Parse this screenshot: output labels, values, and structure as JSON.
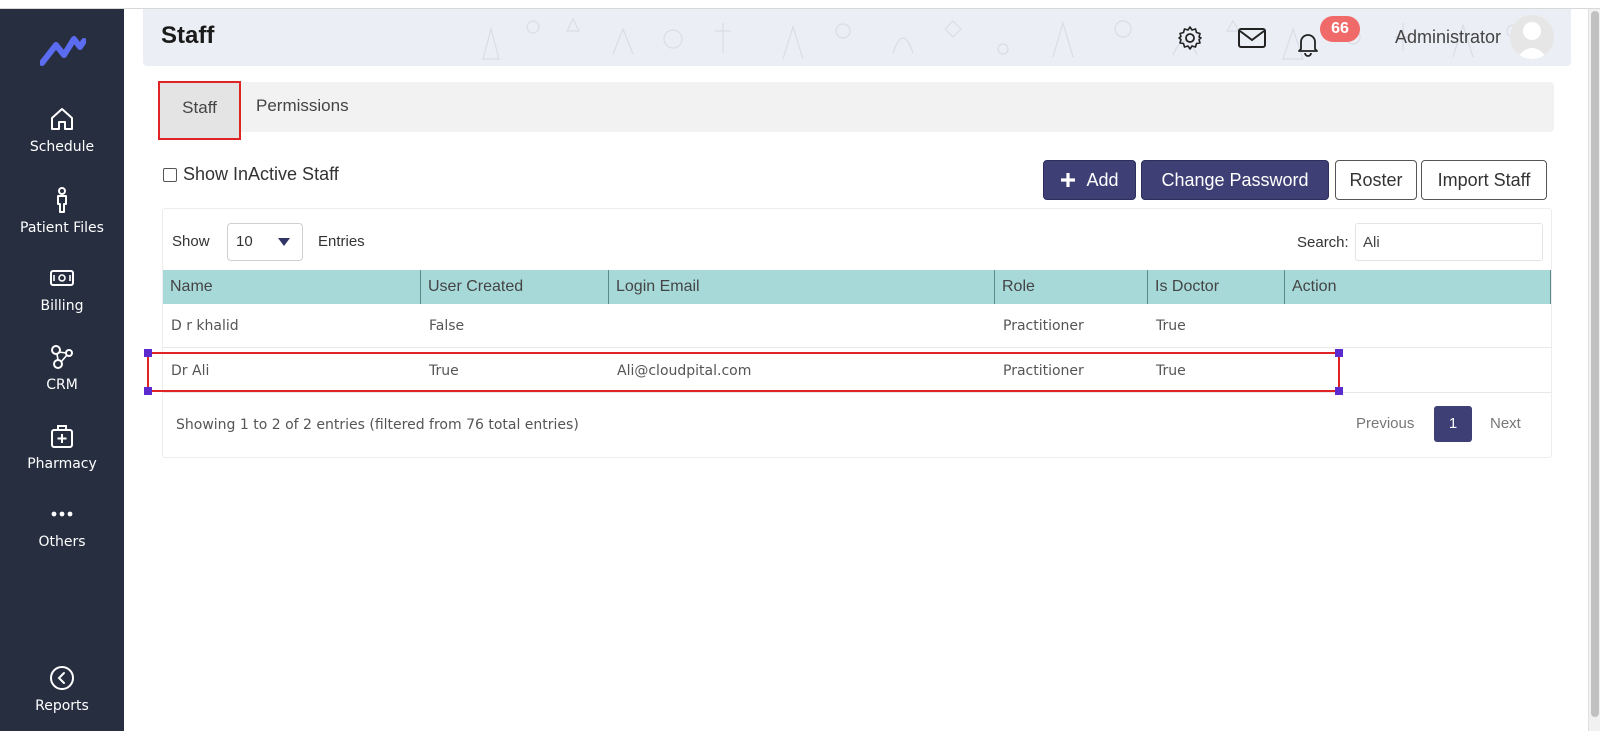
{
  "header": {
    "title": "Staff",
    "notification_count": "66",
    "user_name": "Administrator"
  },
  "sidebar": {
    "items": [
      {
        "label": "Schedule",
        "icon": "home-icon"
      },
      {
        "label": "Patient Files",
        "icon": "person-icon"
      },
      {
        "label": "Billing",
        "icon": "money-icon"
      },
      {
        "label": "CRM",
        "icon": "network-icon"
      },
      {
        "label": "Pharmacy",
        "icon": "medical-bag-icon"
      },
      {
        "label": "Others",
        "icon": "ellipsis-icon"
      },
      {
        "label": "Reports",
        "icon": "chevron-left-circle-icon"
      }
    ]
  },
  "tabs": [
    {
      "label": "Staff",
      "active": true
    },
    {
      "label": "Permissions",
      "active": false
    }
  ],
  "filters": {
    "show_inactive_label": "Show InActive Staff",
    "show_inactive_checked": false
  },
  "actions": {
    "add_label": "Add",
    "change_password_label": "Change Password",
    "roster_label": "Roster",
    "import_label": "Import Staff"
  },
  "table": {
    "show_label": "Show",
    "page_size": "10",
    "entries_label": "Entries",
    "search_label": "Search:",
    "search_value": "Ali",
    "columns": [
      "Name",
      "User Created",
      "Login Email",
      "Role",
      "Is Doctor",
      "Action"
    ],
    "rows": [
      {
        "name": "D r khalid",
        "user_created": "False",
        "login_email": "",
        "role": "Practitioner",
        "is_doctor": "True",
        "action": ""
      },
      {
        "name": "Dr Ali",
        "user_created": "True",
        "login_email": "Ali@cloudpital.com",
        "role": "Practitioner",
        "is_doctor": "True",
        "action": ""
      }
    ],
    "info": "Showing 1 to 2 of 2 entries (filtered from 76 total entries)",
    "pagination": {
      "previous": "Previous",
      "current": "1",
      "next": "Next"
    }
  },
  "colors": {
    "sidebar_bg": "#262e40",
    "accent": "#3e3f75",
    "table_header": "#a8d9d9",
    "highlight": "#e02424",
    "badge": "#f06a6a"
  }
}
